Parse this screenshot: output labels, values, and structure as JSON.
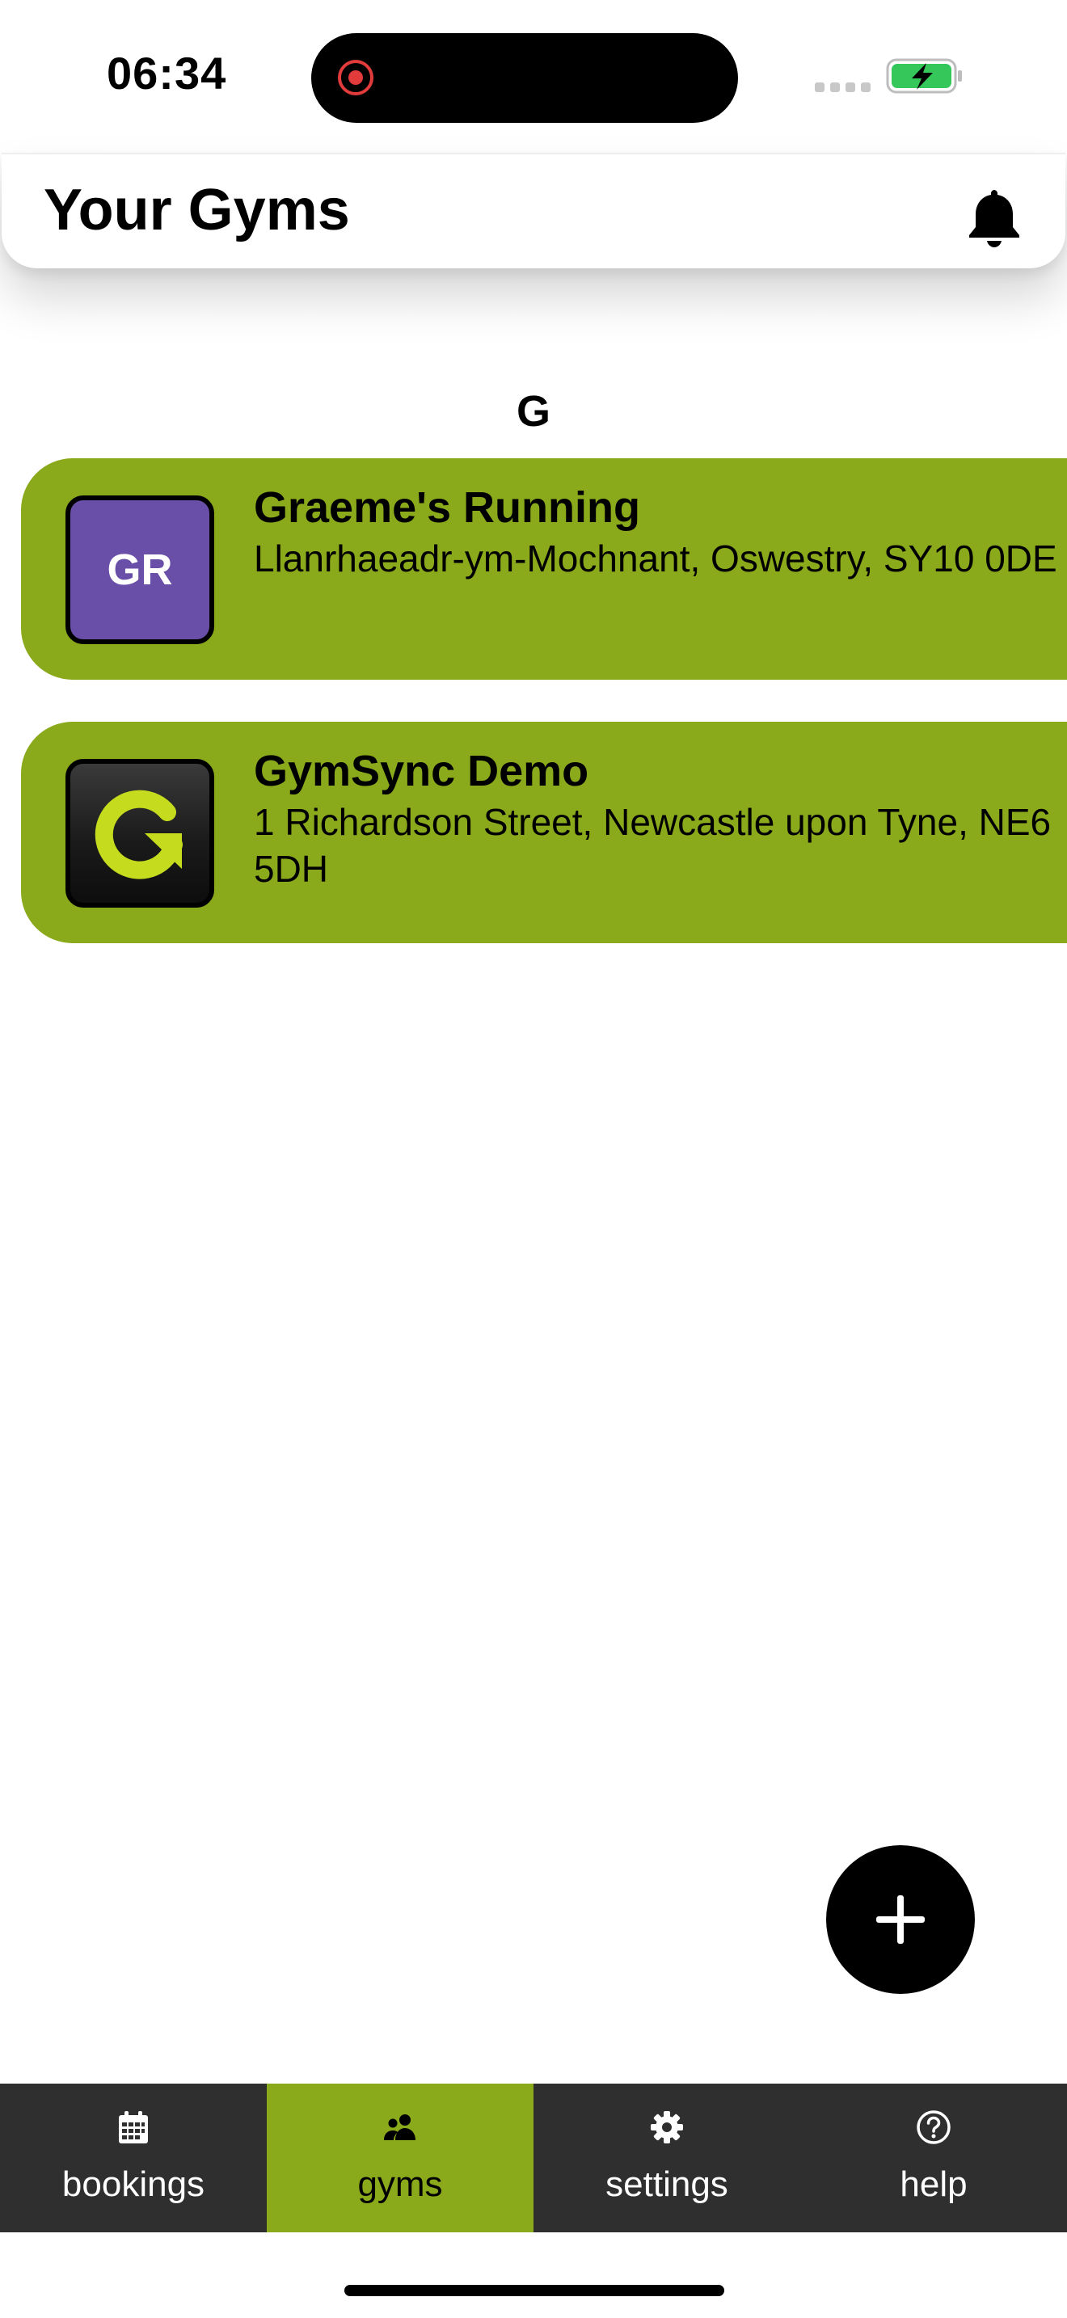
{
  "status_bar": {
    "time": "06:34"
  },
  "header": {
    "title": "Your Gyms"
  },
  "section": {
    "letter": "G"
  },
  "gyms": [
    {
      "name": "Graeme's Running",
      "address": "Llanrhaeadr-ym-Mochnant, Oswestry, SY10 0DE",
      "logo_initials": "GR",
      "logo_color": "#6a4fa8"
    },
    {
      "name": "GymSync Demo",
      "address": "1 Richardson Street, Newcastle upon Tyne, NE6 5DH",
      "logo_icon": "gymsync-logo-icon"
    }
  ],
  "tabs": [
    {
      "label": "bookings",
      "icon": "calendar-icon",
      "active": false
    },
    {
      "label": "gyms",
      "icon": "users-icon",
      "active": true
    },
    {
      "label": "settings",
      "icon": "gear-icon",
      "active": false
    },
    {
      "label": "help",
      "icon": "help-icon",
      "active": false
    }
  ],
  "colors": {
    "accent": "#8aa91b",
    "tab_bar": "#2f2f2f",
    "fab": "#000000"
  }
}
